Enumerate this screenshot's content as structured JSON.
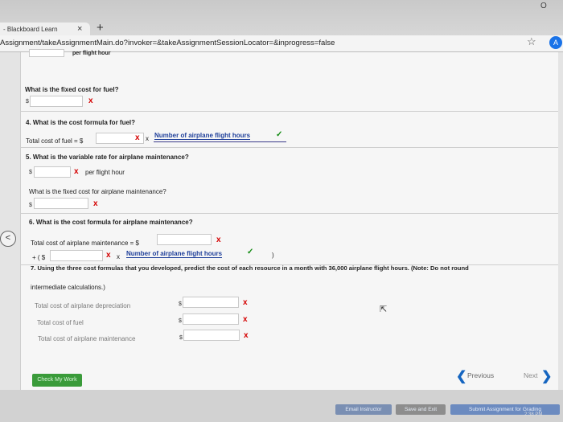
{
  "browser": {
    "tab_title": "- Blackboard Learn",
    "tab_close": "×",
    "new_tab": "+",
    "url": "Assignment/takeAssignmentMain.do?invoker=&takeAssignmentSessionLocator=&inprogress=false",
    "profile_initial": "A",
    "window_control": "O"
  },
  "q_fuel_fixed": {
    "partial_header": "per flight hour",
    "label": "What is the fixed cost for fuel?",
    "dollar": "$",
    "mark": "x"
  },
  "q4": {
    "label": "4.  What is the cost formula for fuel?",
    "formula_prefix": "Total cost of fuel =  $",
    "mark": "x",
    "times": "x",
    "link": "Number of airplane flight hours",
    "check": "✓"
  },
  "q5": {
    "label": "5.  What is the variable rate for airplane maintenance?",
    "dollar": "$",
    "mark": "x",
    "unit": "per flight hour",
    "fixed_label": "What is the fixed cost for airplane maintenance?",
    "fixed_dollar": "$",
    "fixed_mark": "x"
  },
  "q6": {
    "label": "6.  What is the cost formula for airplane maintenance?",
    "formula_prefix": "Total cost of airplane maintenance =  $",
    "mark1": "x",
    "plus": "+ ( $",
    "mark2": "x",
    "times": "x",
    "link": "Number of airplane flight hours",
    "check": "✓",
    "close_paren": ")"
  },
  "q7": {
    "label_line1": "7.  Using the three cost formulas that you developed, predict the cost of each resource in a month with 36,000 airplane flight hours. (Note: Do not round",
    "label_line2": "intermediate calculations.)",
    "rows": [
      {
        "label": "Total cost of airplane depreciation",
        "dollar": "$",
        "mark": "x"
      },
      {
        "label": "Total cost of fuel",
        "dollar": "$",
        "mark": "x"
      },
      {
        "label": "Total cost of airplane maintenance",
        "dollar": "$",
        "mark": "x"
      }
    ]
  },
  "footer": {
    "check_my_work": "Check My Work",
    "previous": "Previous",
    "next": "Next",
    "prev_arrow": "❮",
    "next_arrow": "❯",
    "back_arrow": "<",
    "email_instructor": "Email Instructor",
    "save_and_exit": "Save and Exit",
    "submit": "Submit Assignment for Grading",
    "time": "2:38 PM"
  }
}
